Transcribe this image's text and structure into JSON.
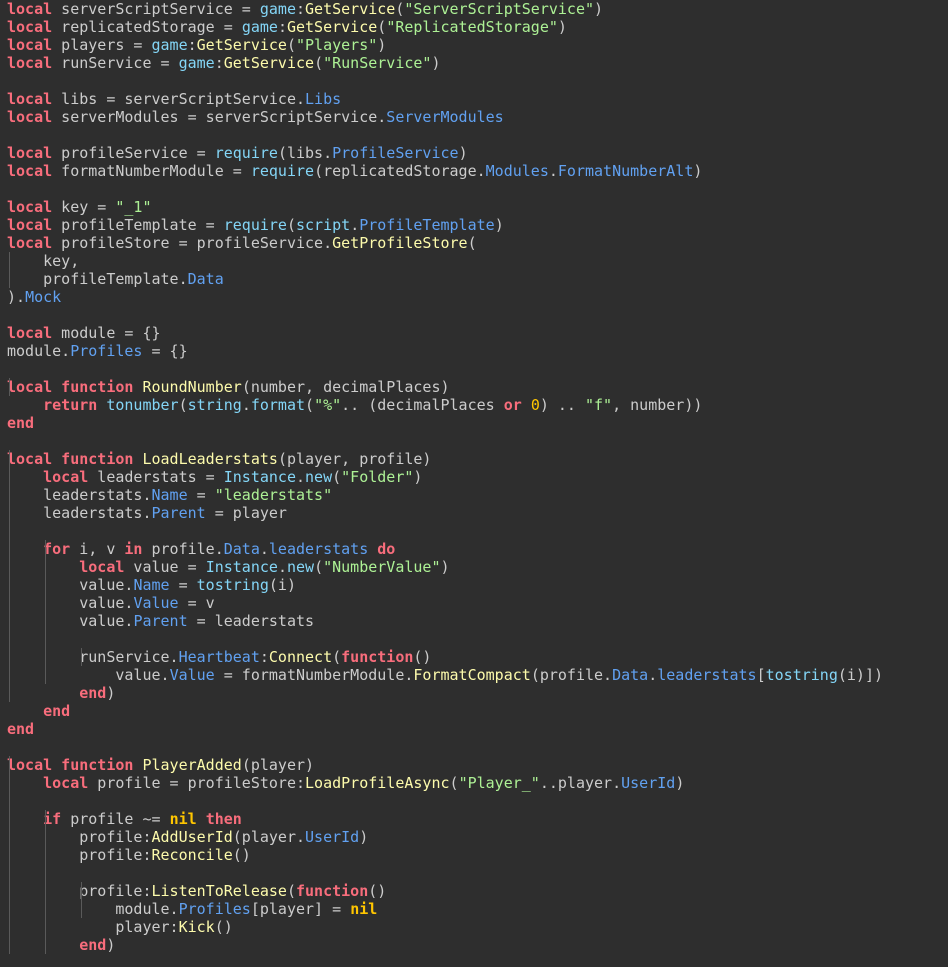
{
  "editor": {
    "background": "#2e2e2e",
    "colors": {
      "keyword": "#f86d7c",
      "string": "#adf195",
      "number": "#ffc600",
      "function": "#fdfbac",
      "property": "#61a1f1",
      "builtin": "#84d6f7",
      "text": "#cccccc"
    },
    "lines": [
      [
        [
          0,
          "kw",
          "local"
        ],
        [
          0,
          "t",
          " serverScriptService = "
        ],
        [
          0,
          "bi",
          "game"
        ],
        [
          0,
          "t",
          ":"
        ],
        [
          0,
          "fn",
          "GetService"
        ],
        [
          0,
          "t",
          "("
        ],
        [
          0,
          "str",
          "\"ServerScriptService\""
        ],
        [
          0,
          "t",
          ")"
        ]
      ],
      [
        [
          0,
          "kw",
          "local"
        ],
        [
          0,
          "t",
          " replicatedStorage = "
        ],
        [
          0,
          "bi",
          "game"
        ],
        [
          0,
          "t",
          ":"
        ],
        [
          0,
          "fn",
          "GetService"
        ],
        [
          0,
          "t",
          "("
        ],
        [
          0,
          "str",
          "\"ReplicatedStorage\""
        ],
        [
          0,
          "t",
          ")"
        ]
      ],
      [
        [
          0,
          "kw",
          "local"
        ],
        [
          0,
          "t",
          " players = "
        ],
        [
          0,
          "bi",
          "game"
        ],
        [
          0,
          "t",
          ":"
        ],
        [
          0,
          "fn",
          "GetService"
        ],
        [
          0,
          "t",
          "("
        ],
        [
          0,
          "str",
          "\"Players\""
        ],
        [
          0,
          "t",
          ")"
        ]
      ],
      [
        [
          0,
          "kw",
          "local"
        ],
        [
          0,
          "t",
          " runService = "
        ],
        [
          0,
          "bi",
          "game"
        ],
        [
          0,
          "t",
          ":"
        ],
        [
          0,
          "fn",
          "GetService"
        ],
        [
          0,
          "t",
          "("
        ],
        [
          0,
          "str",
          "\"RunService\""
        ],
        [
          0,
          "t",
          ")"
        ]
      ],
      [],
      [
        [
          0,
          "kw",
          "local"
        ],
        [
          0,
          "t",
          " libs = serverScriptService."
        ],
        [
          0,
          "prop",
          "Libs"
        ]
      ],
      [
        [
          0,
          "kw",
          "local"
        ],
        [
          0,
          "t",
          " serverModules = serverScriptService."
        ],
        [
          0,
          "prop",
          "ServerModules"
        ]
      ],
      [],
      [
        [
          0,
          "kw",
          "local"
        ],
        [
          0,
          "t",
          " profileService = "
        ],
        [
          0,
          "bi",
          "require"
        ],
        [
          0,
          "t",
          "(libs."
        ],
        [
          0,
          "prop",
          "ProfileService"
        ],
        [
          0,
          "t",
          ")"
        ]
      ],
      [
        [
          0,
          "kw",
          "local"
        ],
        [
          0,
          "t",
          " formatNumberModule = "
        ],
        [
          0,
          "bi",
          "require"
        ],
        [
          0,
          "t",
          "(replicatedStorage."
        ],
        [
          0,
          "prop",
          "Modules"
        ],
        [
          0,
          "t",
          "."
        ],
        [
          0,
          "prop",
          "FormatNumberAlt"
        ],
        [
          0,
          "t",
          ")"
        ]
      ],
      [],
      [
        [
          0,
          "kw",
          "local"
        ],
        [
          0,
          "t",
          " key = "
        ],
        [
          0,
          "str",
          "\"_1\""
        ]
      ],
      [
        [
          0,
          "kw",
          "local"
        ],
        [
          0,
          "t",
          " profileTemplate = "
        ],
        [
          0,
          "bi",
          "require"
        ],
        [
          0,
          "t",
          "("
        ],
        [
          0,
          "bi",
          "script"
        ],
        [
          0,
          "t",
          "."
        ],
        [
          0,
          "prop",
          "ProfileTemplate"
        ],
        [
          0,
          "t",
          ")"
        ]
      ],
      [
        [
          0,
          "kw",
          "local"
        ],
        [
          0,
          "t",
          " profileStore = profileService."
        ],
        [
          0,
          "fn",
          "GetProfileStore"
        ],
        [
          0,
          "t",
          "("
        ]
      ],
      [
        [
          1,
          "t",
          "key,"
        ]
      ],
      [
        [
          1,
          "t",
          "profileTemplate."
        ],
        [
          1,
          "prop",
          "Data"
        ]
      ],
      [
        [
          0,
          "t",
          ")."
        ],
        [
          0,
          "prop",
          "Mock"
        ]
      ],
      [],
      [
        [
          0,
          "kw",
          "local"
        ],
        [
          0,
          "t",
          " module = {}"
        ]
      ],
      [
        [
          0,
          "t",
          "module."
        ],
        [
          0,
          "prop",
          "Profiles"
        ],
        [
          0,
          "t",
          " = {}"
        ]
      ],
      [],
      [
        [
          0,
          "kw",
          "local function"
        ],
        [
          0,
          "t",
          " "
        ],
        [
          0,
          "fn",
          "RoundNumber"
        ],
        [
          0,
          "t",
          "(number, decimalPlaces)"
        ]
      ],
      [
        [
          1,
          "kw",
          "return"
        ],
        [
          1,
          "t",
          " "
        ],
        [
          1,
          "bi",
          "tonumber"
        ],
        [
          1,
          "t",
          "("
        ],
        [
          1,
          "bi",
          "string"
        ],
        [
          1,
          "t",
          "."
        ],
        [
          1,
          "bi",
          "format"
        ],
        [
          1,
          "t",
          "("
        ],
        [
          1,
          "str",
          "\"%\""
        ],
        [
          1,
          "t",
          ".. (decimalPlaces "
        ],
        [
          1,
          "kw",
          "or"
        ],
        [
          1,
          "t",
          " "
        ],
        [
          1,
          "num",
          "0"
        ],
        [
          1,
          "t",
          ") .. "
        ],
        [
          1,
          "str",
          "\"f\""
        ],
        [
          1,
          "t",
          ", number))"
        ]
      ],
      [
        [
          0,
          "kw",
          "end"
        ]
      ],
      [],
      [
        [
          0,
          "kw",
          "local function"
        ],
        [
          0,
          "t",
          " "
        ],
        [
          0,
          "fn",
          "LoadLeaderstats"
        ],
        [
          0,
          "t",
          "(player, profile)"
        ]
      ],
      [
        [
          1,
          "kw",
          "local"
        ],
        [
          1,
          "t",
          " leaderstats = "
        ],
        [
          1,
          "bi",
          "Instance"
        ],
        [
          1,
          "t",
          "."
        ],
        [
          1,
          "bi",
          "new"
        ],
        [
          1,
          "t",
          "("
        ],
        [
          1,
          "str",
          "\"Folder\""
        ],
        [
          1,
          "t",
          ")"
        ]
      ],
      [
        [
          1,
          "t",
          "leaderstats."
        ],
        [
          1,
          "prop",
          "Name"
        ],
        [
          1,
          "t",
          " = "
        ],
        [
          1,
          "str",
          "\"leaderstats\""
        ]
      ],
      [
        [
          1,
          "t",
          "leaderstats."
        ],
        [
          1,
          "prop",
          "Parent"
        ],
        [
          1,
          "t",
          " = player"
        ]
      ],
      [],
      [
        [
          1,
          "kw",
          "for"
        ],
        [
          1,
          "t",
          " i, v "
        ],
        [
          1,
          "kw",
          "in"
        ],
        [
          1,
          "t",
          " profile."
        ],
        [
          1,
          "prop",
          "Data"
        ],
        [
          1,
          "t",
          "."
        ],
        [
          1,
          "prop",
          "leaderstats"
        ],
        [
          1,
          "t",
          " "
        ],
        [
          1,
          "kw",
          "do"
        ]
      ],
      [
        [
          2,
          "kw",
          "local"
        ],
        [
          2,
          "t",
          " value = "
        ],
        [
          2,
          "bi",
          "Instance"
        ],
        [
          2,
          "t",
          "."
        ],
        [
          2,
          "bi",
          "new"
        ],
        [
          2,
          "t",
          "("
        ],
        [
          2,
          "str",
          "\"NumberValue\""
        ],
        [
          2,
          "t",
          ")"
        ]
      ],
      [
        [
          2,
          "t",
          "value."
        ],
        [
          2,
          "prop",
          "Name"
        ],
        [
          2,
          "t",
          " = "
        ],
        [
          2,
          "bi",
          "tostring"
        ],
        [
          2,
          "t",
          "(i)"
        ]
      ],
      [
        [
          2,
          "t",
          "value."
        ],
        [
          2,
          "prop",
          "Value"
        ],
        [
          2,
          "t",
          " = v"
        ]
      ],
      [
        [
          2,
          "t",
          "value."
        ],
        [
          2,
          "prop",
          "Parent"
        ],
        [
          2,
          "t",
          " = leaderstats"
        ]
      ],
      [],
      [
        [
          2,
          "t",
          "runService."
        ],
        [
          2,
          "prop",
          "Heartbeat"
        ],
        [
          2,
          "t",
          ":"
        ],
        [
          2,
          "fn",
          "Connect"
        ],
        [
          2,
          "t",
          "("
        ],
        [
          2,
          "kw",
          "function"
        ],
        [
          2,
          "t",
          "()"
        ]
      ],
      [
        [
          3,
          "t",
          "value."
        ],
        [
          3,
          "prop",
          "Value"
        ],
        [
          3,
          "t",
          " = formatNumberModule."
        ],
        [
          3,
          "fn",
          "FormatCompact"
        ],
        [
          3,
          "t",
          "(profile."
        ],
        [
          3,
          "prop",
          "Data"
        ],
        [
          3,
          "t",
          "."
        ],
        [
          3,
          "prop",
          "leaderstats"
        ],
        [
          3,
          "t",
          "["
        ],
        [
          3,
          "bi",
          "tostring"
        ],
        [
          3,
          "t",
          "(i)])"
        ]
      ],
      [
        [
          2,
          "kw",
          "end"
        ],
        [
          2,
          "t",
          ")"
        ]
      ],
      [
        [
          1,
          "kw",
          "end"
        ]
      ],
      [
        [
          0,
          "kw",
          "end"
        ]
      ],
      [],
      [
        [
          0,
          "kw",
          "local function"
        ],
        [
          0,
          "t",
          " "
        ],
        [
          0,
          "fn",
          "PlayerAdded"
        ],
        [
          0,
          "t",
          "(player)"
        ]
      ],
      [
        [
          1,
          "kw",
          "local"
        ],
        [
          1,
          "t",
          " profile = profileStore:"
        ],
        [
          1,
          "fn",
          "LoadProfileAsync"
        ],
        [
          1,
          "t",
          "("
        ],
        [
          1,
          "str",
          "\"Player_\""
        ],
        [
          1,
          "t",
          "..player."
        ],
        [
          1,
          "prop",
          "UserId"
        ],
        [
          1,
          "t",
          ")"
        ]
      ],
      [],
      [
        [
          1,
          "kw",
          "if"
        ],
        [
          1,
          "t",
          " profile ~= "
        ],
        [
          1,
          "nil",
          "nil"
        ],
        [
          1,
          "t",
          " "
        ],
        [
          1,
          "kw",
          "then"
        ]
      ],
      [
        [
          2,
          "t",
          "profile:"
        ],
        [
          2,
          "fn",
          "AddUserId"
        ],
        [
          2,
          "t",
          "(player."
        ],
        [
          2,
          "prop",
          "UserId"
        ],
        [
          2,
          "t",
          ")"
        ]
      ],
      [
        [
          2,
          "t",
          "profile:"
        ],
        [
          2,
          "fn",
          "Reconcile"
        ],
        [
          2,
          "t",
          "()"
        ]
      ],
      [],
      [
        [
          2,
          "t",
          "profile:"
        ],
        [
          2,
          "fn",
          "ListenToRelease"
        ],
        [
          2,
          "t",
          "("
        ],
        [
          2,
          "kw",
          "function"
        ],
        [
          2,
          "t",
          "()"
        ]
      ],
      [
        [
          3,
          "t",
          "module."
        ],
        [
          3,
          "prop",
          "Profiles"
        ],
        [
          3,
          "t",
          "[player] = "
        ],
        [
          3,
          "nil",
          "nil"
        ]
      ],
      [
        [
          3,
          "t",
          "player:"
        ],
        [
          3,
          "fn",
          "Kick"
        ],
        [
          3,
          "t",
          "()"
        ]
      ],
      [
        [
          2,
          "kw",
          "end"
        ],
        [
          2,
          "t",
          ")"
        ]
      ]
    ],
    "guides": [
      [],
      [],
      [],
      [],
      [],
      [],
      [],
      [],
      [],
      [],
      [],
      [],
      [],
      [],
      [
        0
      ],
      [
        0
      ],
      [],
      [],
      [],
      [],
      [],
      [
        0
      ],
      [],
      [],
      [],
      [
        0
      ],
      [
        0
      ],
      [
        0
      ],
      [
        0
      ],
      [
        0
      ],
      [
        0,
        1
      ],
      [
        0,
        1
      ],
      [
        0,
        1
      ],
      [
        0,
        1
      ],
      [
        0,
        1
      ],
      [
        0,
        1
      ],
      [
        0,
        1,
        2
      ],
      [
        0,
        1
      ],
      [
        0
      ],
      [],
      [],
      [],
      [
        0
      ],
      [
        0
      ],
      [
        0
      ],
      [
        0,
        1
      ],
      [
        0,
        1
      ],
      [
        0,
        1
      ],
      [
        0,
        1
      ],
      [
        0,
        1,
        2
      ],
      [
        0,
        1,
        2
      ],
      [
        0,
        1
      ],
      [
        0,
        1
      ]
    ]
  }
}
